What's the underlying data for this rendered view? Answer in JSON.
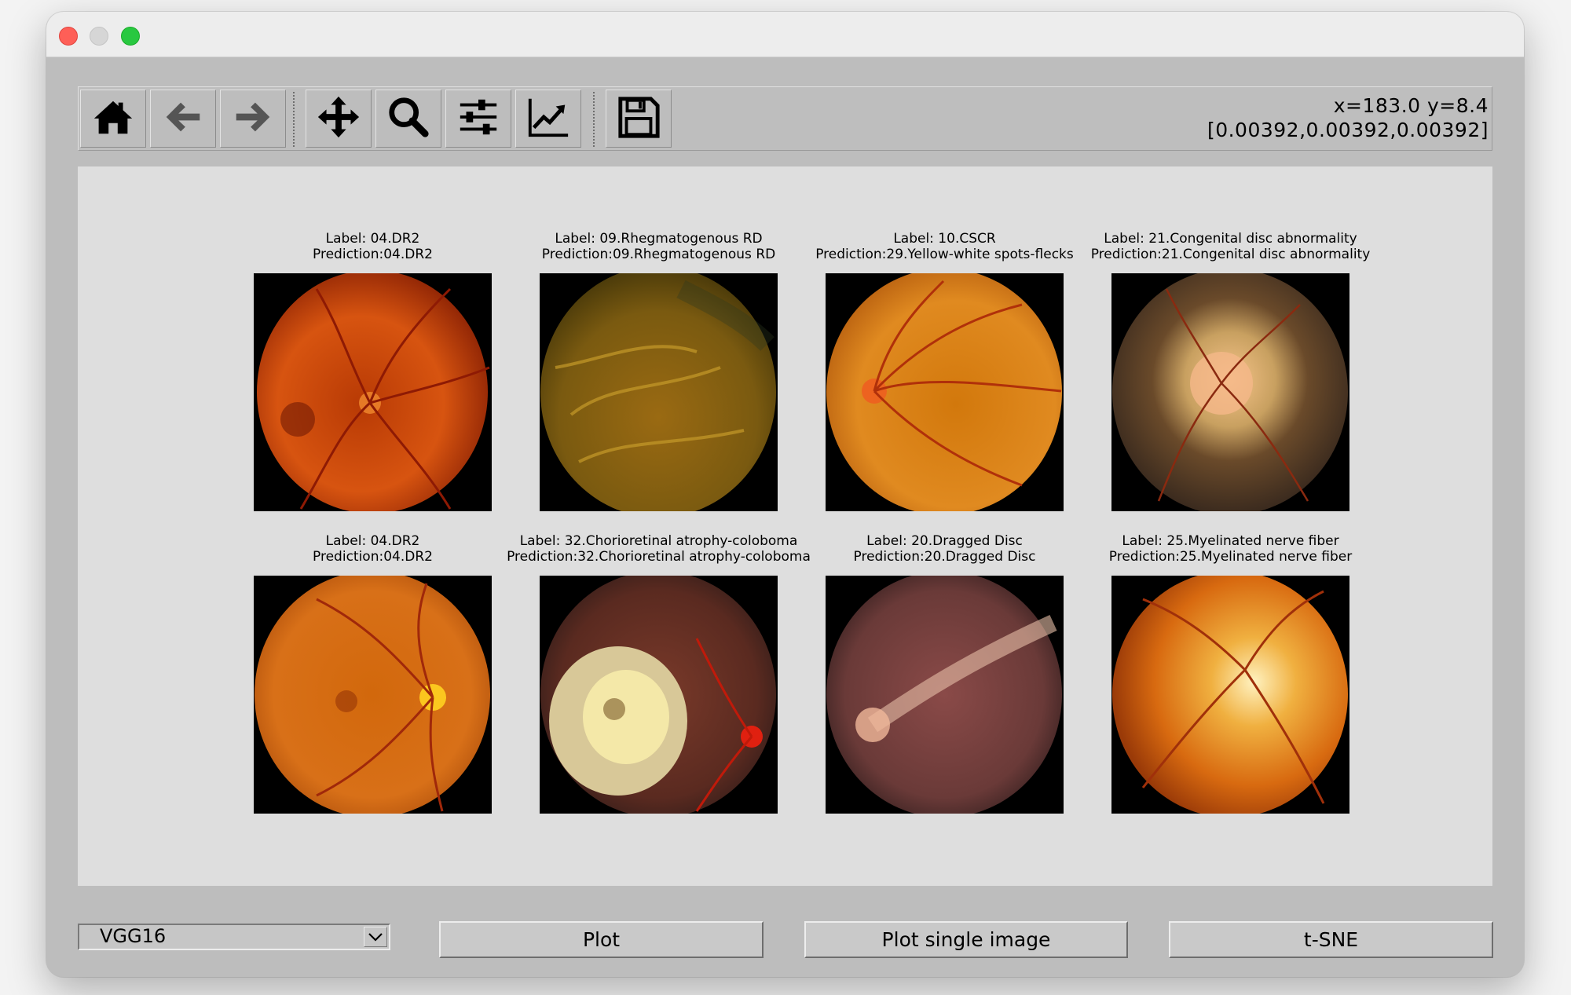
{
  "toolbar": {
    "buttons": [
      {
        "icon": "home-icon"
      },
      {
        "icon": "back-arrow-icon"
      },
      {
        "icon": "forward-arrow-icon"
      },
      {
        "icon": "pan-icon"
      },
      {
        "icon": "zoom-icon"
      },
      {
        "icon": "configure-subplots-icon"
      },
      {
        "icon": "edit-axis-icon"
      },
      {
        "icon": "save-icon"
      }
    ],
    "coords_line1": "x=183.0 y=8.4",
    "coords_line2": "[0.00392,0.00392,0.00392]"
  },
  "grid": [
    {
      "label": "Label: 04.DR2",
      "prediction": "Prediction:04.DR2"
    },
    {
      "label": "Label: 09.Rhegmatogenous RD",
      "prediction": "Prediction:09.Rhegmatogenous RD"
    },
    {
      "label": "Label: 10.CSCR",
      "prediction": "Prediction:29.Yellow-white spots-flecks"
    },
    {
      "label": "Label: 21.Congenital disc abnormality",
      "prediction": "Prediction:21.Congenital disc abnormality"
    },
    {
      "label": "Label: 04.DR2",
      "prediction": "Prediction:04.DR2"
    },
    {
      "label": "Label: 32.Chorioretinal atrophy-coloboma",
      "prediction": "Prediction:32.Chorioretinal atrophy-coloboma"
    },
    {
      "label": "Label: 20.Dragged Disc",
      "prediction": "Prediction:20.Dragged Disc"
    },
    {
      "label": "Label: 25.Myelinated nerve fiber",
      "prediction": "Prediction:25.Myelinated nerve fiber"
    }
  ],
  "controls": {
    "model_select": "VGG16",
    "plot_button": "Plot",
    "plot_single_button": "Plot single image",
    "tsne_button": "t-SNE"
  }
}
